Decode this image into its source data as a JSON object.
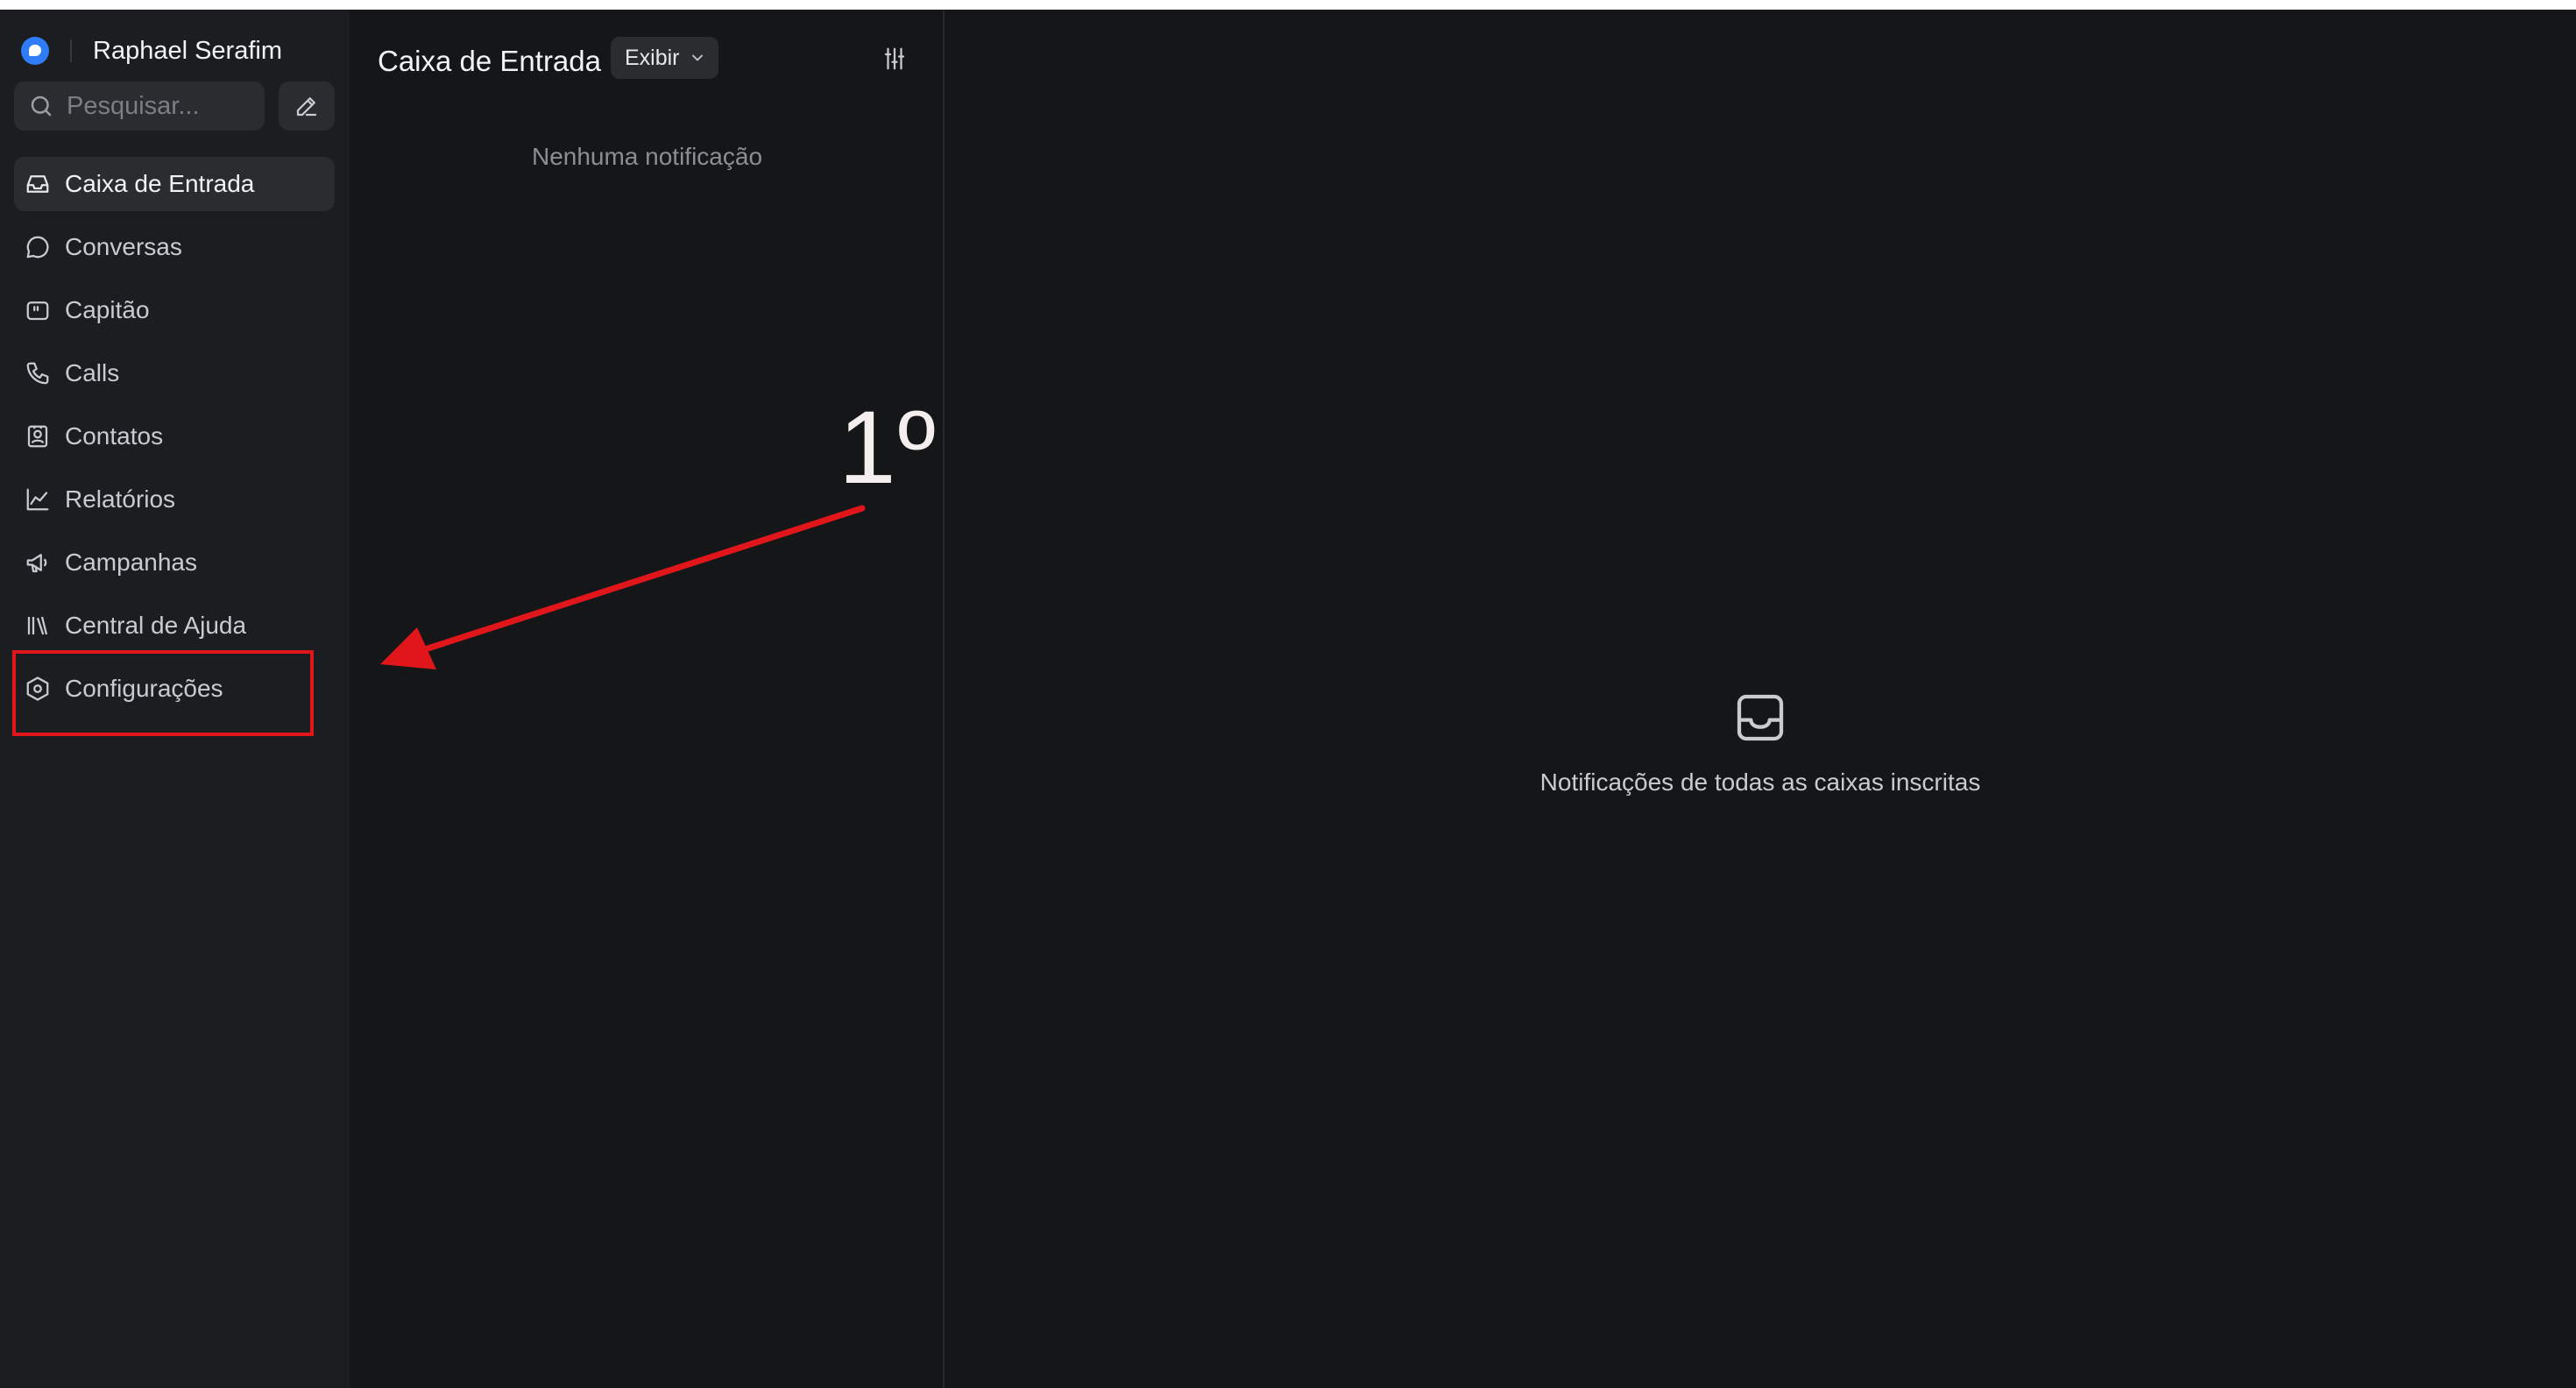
{
  "sidebar": {
    "brand_name": "Raphael Serafim",
    "search_placeholder": "Pesquisar...",
    "items": [
      {
        "label": "Caixa de Entrada",
        "icon": "inbox-icon",
        "active": true
      },
      {
        "label": "Conversas",
        "icon": "chat-bubble-icon"
      },
      {
        "label": "Capitão",
        "icon": "captain-bot-icon"
      },
      {
        "label": "Calls",
        "icon": "phone-icon"
      },
      {
        "label": "Contatos",
        "icon": "contact-card-icon"
      },
      {
        "label": "Relatórios",
        "icon": "line-chart-icon"
      },
      {
        "label": "Campanhas",
        "icon": "megaphone-icon"
      },
      {
        "label": "Central de Ajuda",
        "icon": "library-icon"
      },
      {
        "label": "Configurações",
        "icon": "settings-hexagon-icon"
      }
    ]
  },
  "list": {
    "title": "Caixa de Entrada",
    "view_label": "Exibir",
    "empty_text": "Nenhuma notificação"
  },
  "main": {
    "empty_text": "Notificações de todas as caixas inscritas"
  },
  "annotation": {
    "step_label": "1º",
    "color": "#e0161b"
  },
  "colors": {
    "brand_blue": "#2f7cf6",
    "background": "#151618",
    "sidebar_bg": "#1c1d20"
  }
}
